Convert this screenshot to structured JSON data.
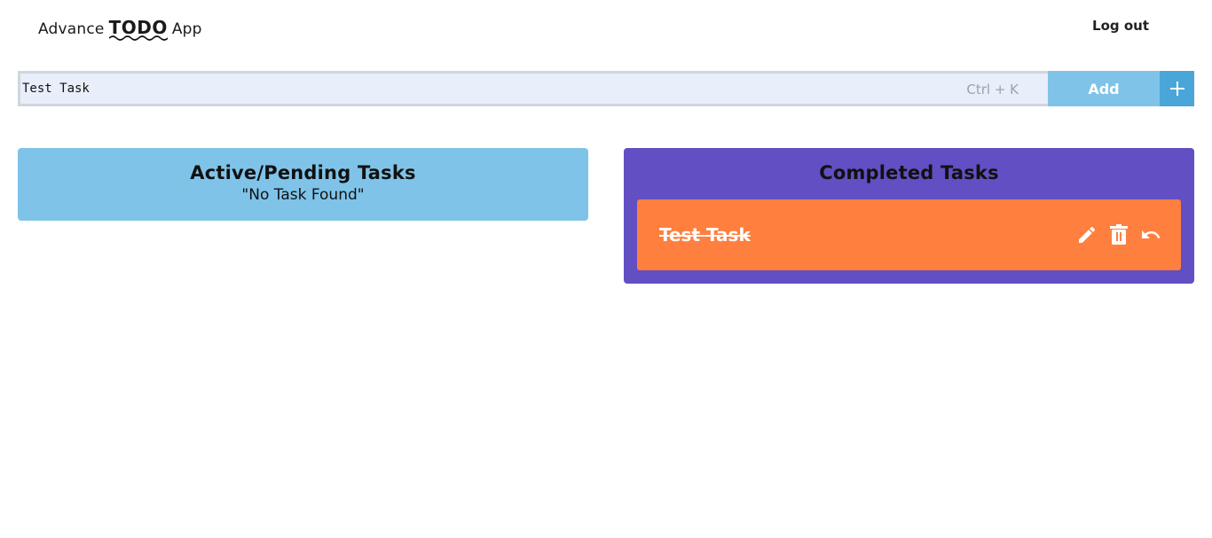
{
  "header": {
    "logo_prefix": "Advance",
    "logo_main": "TODO",
    "logo_suffix": "App",
    "logout_label": "Log out"
  },
  "add_bar": {
    "input_value": "Test Task",
    "shortcut_hint": "Ctrl + K",
    "add_label": "Add",
    "plus_label": "+"
  },
  "active_panel": {
    "title": "Active/Pending Tasks",
    "empty_message": "\"No Task Found\""
  },
  "completed_panel": {
    "title": "Completed Tasks",
    "tasks": [
      {
        "title": "Test Task",
        "actions": [
          "pencil-icon",
          "trash-icon",
          "undo-icon"
        ]
      }
    ]
  },
  "colors": {
    "active_panel": "#7fc3e9",
    "completed_panel": "#614fc3",
    "task_card": "#ff7f3f",
    "add_button": "#7fc3e9",
    "plus_button": "#4aa6d9",
    "input_bg": "#e8eefa"
  }
}
